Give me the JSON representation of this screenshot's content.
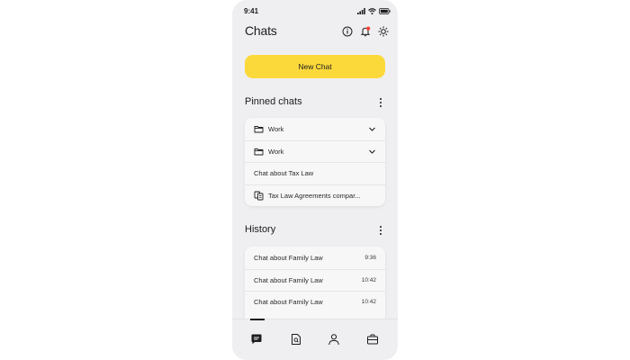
{
  "status_bar": {
    "time": "9:41"
  },
  "header": {
    "title": "Chats",
    "icons": [
      "info-icon",
      "bell-icon",
      "sun-icon"
    ],
    "notification_dot_color": "#ff3b30"
  },
  "new_chat": {
    "label": "New Chat",
    "color": "#fcd93b"
  },
  "pinned": {
    "title": "Pinned chats",
    "items": [
      {
        "label": "Work",
        "icon": "folder-icon",
        "expandable": true
      },
      {
        "label": "Work",
        "icon": "folder-icon",
        "expandable": true
      },
      {
        "label": "Chat about Tax Law",
        "icon": "",
        "expandable": false
      },
      {
        "label": "Tax Law Agreements compar...",
        "icon": "document-compare-icon",
        "expandable": false
      }
    ]
  },
  "history": {
    "title": "History",
    "items": [
      {
        "label": "Chat about Family Law",
        "time": "9:36"
      },
      {
        "label": "Chat about Family Law",
        "time": "10:42"
      },
      {
        "label": "Chat about Family Law",
        "time": "10:42"
      }
    ]
  },
  "tab_bar": {
    "tabs": [
      "chat-icon",
      "document-search-icon",
      "profile-icon",
      "briefcase-icon"
    ],
    "active": "chat-icon"
  }
}
